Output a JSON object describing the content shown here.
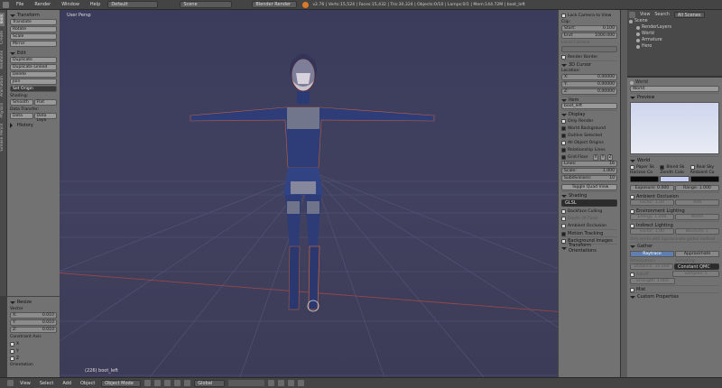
{
  "topbar": {
    "menus": [
      "File",
      "Render",
      "Window",
      "Help"
    ],
    "layout": "Default",
    "scene": "Scene",
    "engine": "Blender Render",
    "stats": "v2.76 | Verts:15,524 | Faces:15,432 | Tris:30,324 | Objects:0/10 | Lamps:0/1 | Mem:144.72M | boot_left"
  },
  "tabs": [
    "Tools",
    "Create",
    "Relations",
    "Animation",
    "Physics",
    "Grease Pencil"
  ],
  "tool": {
    "transform_header": "Transform",
    "transform_buttons": [
      "Translate",
      "Rotate",
      "Scale",
      "Mirror"
    ],
    "edit_header": "Edit",
    "edit_buttons": [
      "Duplicate",
      "Duplicate Linked",
      "Delete",
      "Join"
    ],
    "set_origin": "Set Origin",
    "shading_label": "Shading:",
    "smooth": "Smooth",
    "flat": "Flat",
    "data_transfer_label": "Data Transfer:",
    "data": "Data",
    "data_layout": "Data Layo",
    "history_header": "History"
  },
  "redo": {
    "header": "Resize",
    "vector_label": "Vector",
    "x_label": "X:",
    "x_value": "0.010",
    "y_label": "Y:",
    "y_value": "0.010",
    "z_label": "Z:",
    "z_value": "0.010",
    "constraint_label": "Constraint Axis",
    "axes": [
      "X",
      "Y",
      "Z"
    ],
    "orientation_label": "Orientation"
  },
  "viewport": {
    "label": "User Persp",
    "object_label": "(226) boot_left"
  },
  "bottom": {
    "menus": [
      "View",
      "Select",
      "Add",
      "Object"
    ],
    "mode": "Object Mode",
    "orientation": "Global"
  },
  "npanel": {
    "lock_camera": "Lock Camera to View",
    "clip_label": "Clip:",
    "start_label": "Start:",
    "start_value": "0.100",
    "end_label": "End:",
    "end_value": "1000.000",
    "local_camera": "Local Camera",
    "render_border": "Render Border",
    "cursor_header": "3D Cursor",
    "location_label": "Location:",
    "cx_label": "X:",
    "cx_value": "0.00000",
    "cy_label": "Y:",
    "cy_value": "0.00000",
    "cz_label": "Z:",
    "cz_value": "0.00000",
    "item_header": "Item",
    "item_name": "boot_left",
    "display_header": "Display",
    "only_render": "Only Render",
    "world_background": "World Background",
    "outline_selected": "Outline Selected",
    "all_object_origins": "All Object Origins",
    "relationship_lines": "Relationship Lines",
    "grid_floor": "Grid Floor",
    "grid_axes": [
      "X",
      "Y",
      "Z"
    ],
    "lines_label": "Lines:",
    "lines_value": "16",
    "scale_label": "Scale:",
    "scale_value": "1.000",
    "subdiv_label": "Subdivisions:",
    "subdiv_value": "10",
    "toggle_quad": "Toggle Quad View",
    "shading_header": "Shading",
    "shading_value": "GLSL",
    "backface": "Backface Culling",
    "depth_of_field": "Depth Of Field",
    "ambient_occlusion": "Ambient Occlusion",
    "motion_tracking": "Motion Tracking",
    "background_images": "Background Images",
    "transform_orientations": "Transform Orientations"
  },
  "outliner": {
    "menus": [
      "View",
      "Search",
      "All Scenes"
    ],
    "items": [
      "Scene",
      "RenderLayers",
      "World",
      "Armature",
      "Hero"
    ]
  },
  "props": {
    "breadcrumb": "World",
    "world_name": "World",
    "preview_header": "Preview",
    "world_header": "World",
    "paper_sky": "Paper Sk",
    "blend_sky": "Blend Sk",
    "real_sky": "Real Sky",
    "horizon_label": "Horizon Co",
    "zenith_label": "Zenith Colo",
    "ambient_label": "Ambient Co",
    "horizon_color": "#0a0a0a",
    "zenith_color": "#c8d0f4",
    "ambient_color": "#0a0a0a",
    "exposure": "Exposure: 0.000",
    "range": "Range: 1.000",
    "ao_header": "Ambient Occlusion",
    "ao_factor": "Factor: 1.00",
    "ao_mode": "Add",
    "env_header": "Environment Lighting",
    "env_energy": "Energy: 1.000",
    "env_mode": "White",
    "indirect_header": "Indirect Lighting",
    "ind_factor": "Factor: 1.00",
    "ind_bounces": "Bounces: 1",
    "ind_note": "Only works with Approximate gather method",
    "gather_header": "Gather",
    "raytrace": "Raytrace",
    "approximate": "Approximate",
    "attenuation_label": "Attenuation:",
    "sampling_label": "Sampling:",
    "distance": "Distance: 10.000",
    "sampling_value": "Constant QMC",
    "falloff": "Falloff",
    "samples": "Samples: 5",
    "strength": "Strength: 1.000",
    "mist_header": "Mist",
    "custom_header": "Custom Properties"
  }
}
